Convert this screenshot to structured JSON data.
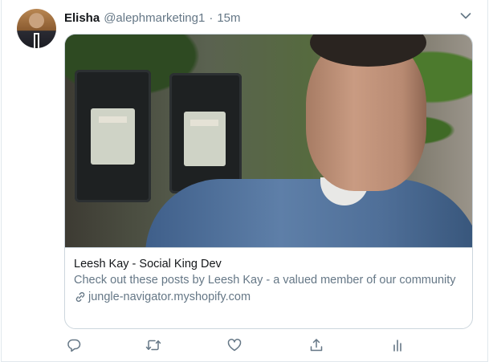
{
  "tweet": {
    "author_name": "Elisha",
    "author_handle": "@alephmarketing1",
    "separator": "·",
    "time": "15m",
    "card": {
      "title": "Leesh Kay - Social King Dev",
      "description": "Check out these posts by Leesh Kay - a valued member of our community",
      "domain": "jungle-navigator.myshopify.com"
    }
  },
  "icons": {
    "caret": "chevron-down-icon",
    "link": "link-icon",
    "reply": "reply-icon",
    "retweet": "retweet-icon",
    "like": "heart-icon",
    "share": "share-icon",
    "analytics": "analytics-icon"
  },
  "colors": {
    "text_primary": "#14171a",
    "text_secondary": "#657786",
    "border": "#ccd6dd"
  }
}
